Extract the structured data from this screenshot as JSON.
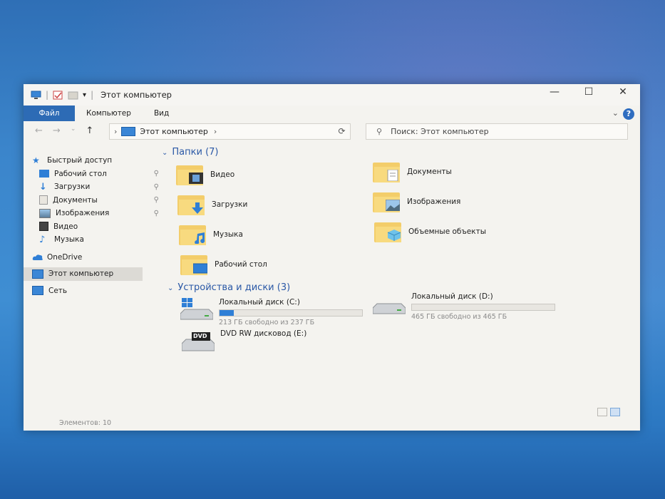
{
  "window": {
    "title": "Этот компьютер",
    "controls": {
      "minimize": "—",
      "maximize": "☐",
      "close": "✕"
    }
  },
  "ribbon": {
    "tabs": [
      "Файл",
      "Компьютер",
      "Вид"
    ]
  },
  "address": {
    "path": "Этот компьютер",
    "search_placeholder": "Поиск: Этот компьютер"
  },
  "sidebar": {
    "quick_access": "Быстрый доступ",
    "items": [
      {
        "label": "Рабочий стол",
        "icon": "desktop-icon",
        "pinned": true
      },
      {
        "label": "Загрузки",
        "icon": "downloads-icon",
        "pinned": true
      },
      {
        "label": "Документы",
        "icon": "documents-icon",
        "pinned": true
      },
      {
        "label": "Изображения",
        "icon": "pictures-icon",
        "pinned": true
      },
      {
        "label": "Видео",
        "icon": "video-icon",
        "pinned": false
      },
      {
        "label": "Музыка",
        "icon": "music-icon",
        "pinned": false
      }
    ],
    "onedrive": "OneDrive",
    "this_pc": "Этот компьютер",
    "network": "Сеть"
  },
  "folders": {
    "header": "Папки (7)",
    "items": [
      {
        "label": "Видео",
        "icon": "video-folder-icon"
      },
      {
        "label": "Документы",
        "icon": "documents-folder-icon"
      },
      {
        "label": "Загрузки",
        "icon": "downloads-folder-icon"
      },
      {
        "label": "Изображения",
        "icon": "pictures-folder-icon"
      },
      {
        "label": "Музыка",
        "icon": "music-folder-icon"
      },
      {
        "label": "Объемные объекты",
        "icon": "3d-objects-folder-icon"
      },
      {
        "label": "Рабочий стол",
        "icon": "desktop-folder-icon"
      }
    ]
  },
  "devices": {
    "header": "Устройства и диски (3)",
    "items": [
      {
        "label": "Локальный диск (C:)",
        "free": "213 ГБ свободно из 237 ГБ",
        "used_fraction": 0.1
      },
      {
        "label": "Локальный диск (D:)",
        "free": "465 ГБ свободно из 465 ГБ",
        "used_fraction": 0.0
      },
      {
        "label": "DVD RW дисковод (E:)",
        "badge": "DVD"
      }
    ]
  },
  "status": {
    "count": "Элементов: 10"
  },
  "colors": {
    "accent": "#2d6bb5",
    "folder": "#f3cd6a",
    "drive_bar": "#2f7fd6"
  }
}
